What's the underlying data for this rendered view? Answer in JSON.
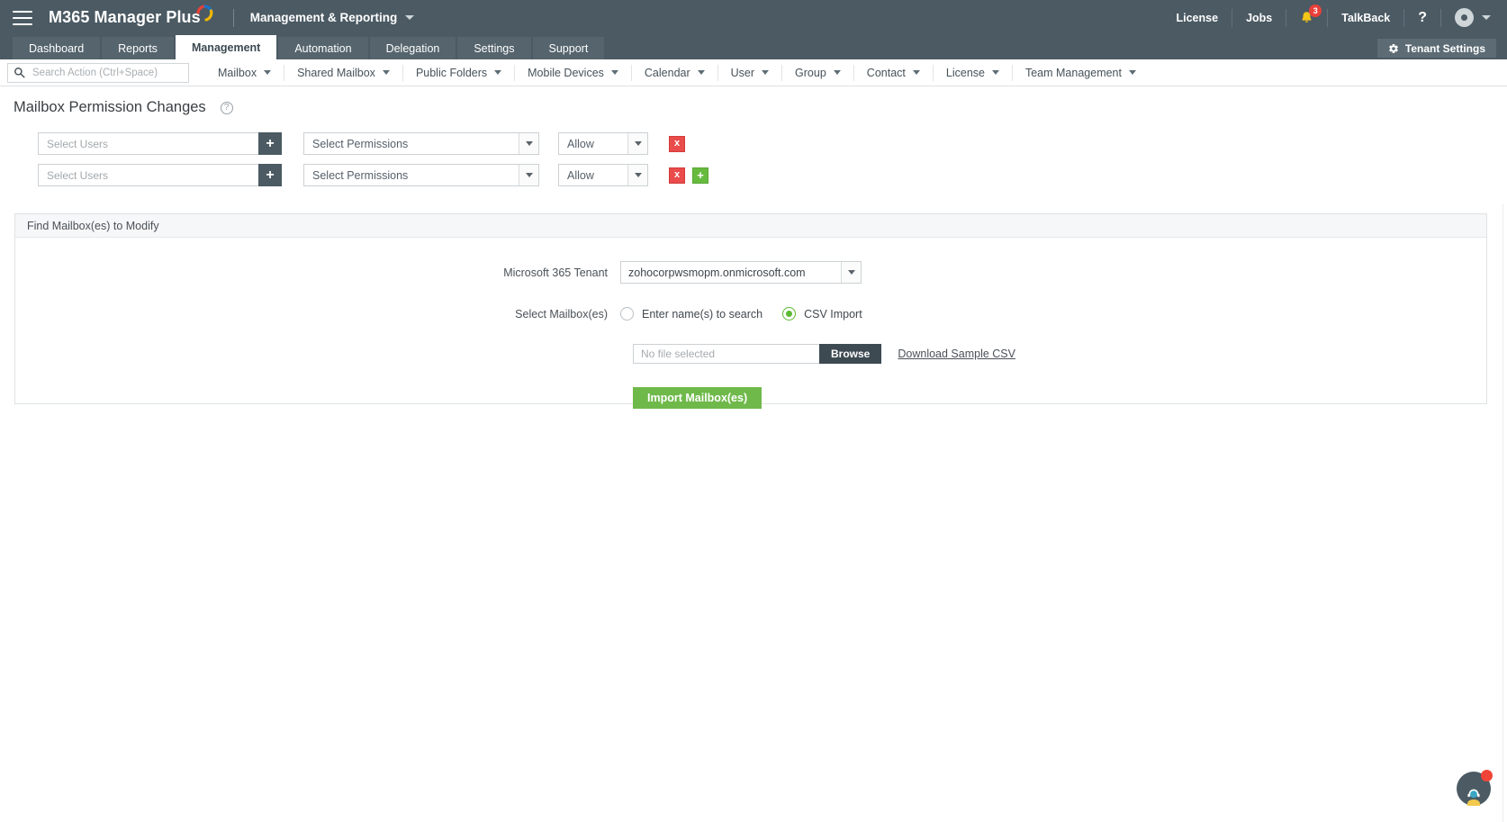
{
  "header": {
    "menu_icon": "hamburger-icon",
    "brand": "M365 Manager Plus",
    "module": "Management & Reporting",
    "right_items": [
      {
        "label": "License",
        "icon": ""
      },
      {
        "label": "Jobs",
        "icon": ""
      },
      {
        "label": "",
        "icon": "bell-icon",
        "badge": "3"
      },
      {
        "label": "TalkBack",
        "icon": ""
      },
      {
        "label": "?",
        "icon": "help-icon"
      },
      {
        "label": "",
        "icon": "user-avatar-icon"
      }
    ]
  },
  "tabs": [
    {
      "label": "Dashboard",
      "active": false
    },
    {
      "label": "Reports",
      "active": false
    },
    {
      "label": "Management",
      "active": true
    },
    {
      "label": "Automation",
      "active": false
    },
    {
      "label": "Delegation",
      "active": false
    },
    {
      "label": "Settings",
      "active": false
    },
    {
      "label": "Support",
      "active": false
    }
  ],
  "tenant_settings_button": {
    "label": "Tenant Settings",
    "icon": "gear-icon"
  },
  "subnav": {
    "search": {
      "placeholder": "Search Action (Ctrl+Space)",
      "value": "",
      "icon": "search-icon"
    },
    "items": [
      {
        "label": "Mailbox"
      },
      {
        "label": "Shared Mailbox"
      },
      {
        "label": "Public Folders"
      },
      {
        "label": "Mobile Devices"
      },
      {
        "label": "Calendar"
      },
      {
        "label": "User"
      },
      {
        "label": "Group"
      },
      {
        "label": "Contact"
      },
      {
        "label": "License"
      },
      {
        "label": "Team Management"
      }
    ]
  },
  "page": {
    "title": "Mailbox Permission Changes",
    "help_icon": "question-mark-icon"
  },
  "permission_rows": [
    {
      "users_placeholder": "Select Users",
      "users_value": "",
      "permissions_label": "Select Permissions",
      "access_label": "Allow",
      "remove_label": "x",
      "add_label": "+",
      "show_add": false
    },
    {
      "users_placeholder": "Select Users",
      "users_value": "",
      "permissions_label": "Select Permissions",
      "access_label": "Allow",
      "remove_label": "x",
      "add_label": "+",
      "show_add": true
    }
  ],
  "find_panel": {
    "header": "Find Mailbox(es) to Modify",
    "tenant_label": "Microsoft 365 Tenant",
    "tenant_value": "zohocorpwsmopm.onmicrosoft.com",
    "select_mailbox_label": "Select Mailbox(es)",
    "radio_enter_names": "Enter name(s) to search",
    "radio_csv_import": "CSV Import",
    "selected_radio": "csv",
    "file_placeholder": "No file selected",
    "browse_label": "Browse",
    "download_sample_label": "Download Sample CSV",
    "import_button_label": "Import Mailbox(es)"
  },
  "chat": {
    "icon": "support-agent-icon",
    "badge": ""
  },
  "colors": {
    "header_bg": "#4b5a63",
    "accent_green": "#6fb94a",
    "danger_red": "#ea4b4b",
    "badge_red": "#e8413a",
    "radio_green": "#5cb934"
  }
}
